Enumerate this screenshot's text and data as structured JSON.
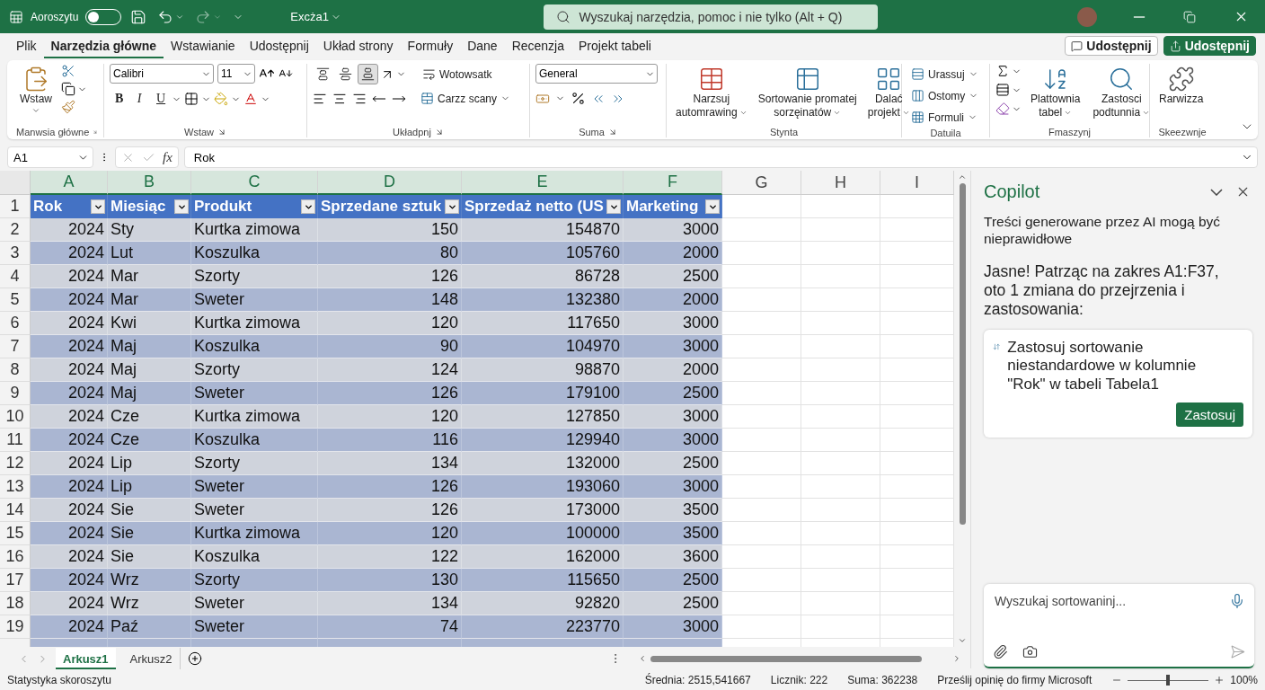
{
  "title_bar": {
    "autosave_label": "Aoroszytu",
    "autosave_on": false,
    "file_name": "Excża1",
    "search_placeholder": "Wyszukaj narzędzia, pomoc i nie tylko (Alt + Q)"
  },
  "menu_tabs": [
    {
      "label": "Plik",
      "selected": false
    },
    {
      "label": "Narzędzia główne",
      "selected": true
    },
    {
      "label": "Wstawianie",
      "selected": false
    },
    {
      "label": "Udostępnij",
      "selected": false
    },
    {
      "label": "Układ strony",
      "selected": false
    },
    {
      "label": "Formuły",
      "selected": false
    },
    {
      "label": "Dane",
      "selected": false
    },
    {
      "label": "Recenzja",
      "selected": false
    },
    {
      "label": "Projekt tabeli",
      "selected": false
    }
  ],
  "share_buttons": [
    "Udostępnij",
    "Udostępnij"
  ],
  "ribbon": {
    "clipboard": {
      "label": "Manwsia główne",
      "paste": "Wstaw"
    },
    "font": {
      "label": "Wstaw",
      "font": "Calibri",
      "size": "11",
      "styles": [
        "B",
        "I",
        "U"
      ]
    },
    "alignment": {
      "label": "Układpnj",
      "vertical_align": [
        {
          "selected": false
        },
        {
          "selected": false
        },
        {
          "selected": true
        }
      ],
      "wrap": "Wotowsatk",
      "merge": "Carzz scany"
    },
    "number": {
      "label": "Suma",
      "format": "General"
    },
    "styles": {
      "label": "Stynta",
      "buttons": [
        [
          "Narzsuj",
          "automrawing"
        ],
        [
          "Sortowanie promatej",
          "sorzęinatów"
        ],
        [
          "Dalać",
          "projekt"
        ]
      ]
    },
    "cells": {
      "label": "Datuila",
      "buttons": [
        "Urassuj",
        "Ostomy",
        "Formuli"
      ]
    },
    "editing": {
      "label": "Fmaszynj",
      "buttons": [
        [
          "Plattownia",
          "tabel"
        ],
        [
          "Zastosci",
          "podtunnia"
        ]
      ]
    },
    "addins": {
      "label": "Skeezwnje",
      "button": "Rarwizza"
    }
  },
  "formula_bar": {
    "cell_ref": "A1",
    "fx": "fx",
    "value": "Rok"
  },
  "columns": [
    {
      "label": "A",
      "selected": true
    },
    {
      "label": "B",
      "selected": true
    },
    {
      "label": "C",
      "selected": true
    },
    {
      "label": "D",
      "selected": true
    },
    {
      "label": "E",
      "selected": true
    },
    {
      "label": "F",
      "selected": true
    },
    {
      "label": "G",
      "selected": false
    },
    {
      "label": "H",
      "selected": false
    },
    {
      "label": "I",
      "selected": false
    }
  ],
  "row_numbers": [
    "1",
    "2",
    "3",
    "4",
    "5",
    "6",
    "7",
    "8",
    "9",
    "10",
    "11",
    "12",
    "13",
    "14",
    "15",
    "16",
    "17",
    "18",
    "19"
  ],
  "table": {
    "headers": [
      "Rok",
      "Miesiąc",
      "Produkt",
      "Sprzedane sztuk",
      "Sprzedaż netto (US",
      "Marketing"
    ],
    "rows": [
      [
        "2024",
        "Sty",
        "Kurtka zimowa",
        "150",
        "154870",
        "3000"
      ],
      [
        "2024",
        "Lut",
        "Koszulka",
        "80",
        "105760",
        "2000"
      ],
      [
        "2024",
        "Mar",
        "Szorty",
        "126",
        "86728",
        "2500"
      ],
      [
        "2024",
        "Mar",
        "Sweter",
        "148",
        "132380",
        "2000"
      ],
      [
        "2024",
        "Kwi",
        "Kurtka zimowa",
        "120",
        "117650",
        "3000"
      ],
      [
        "2024",
        "Maj",
        "Koszulka",
        "90",
        "104970",
        "3000"
      ],
      [
        "2024",
        "Maj",
        "Szorty",
        "124",
        "98870",
        "2000"
      ],
      [
        "2024",
        "Maj",
        "Sweter",
        "126",
        "179100",
        "2500"
      ],
      [
        "2024",
        "Cze",
        "Kurtka zimowa",
        "120",
        "127850",
        "3000"
      ],
      [
        "2024",
        "Cze",
        "Koszulka",
        "116",
        "129940",
        "3000"
      ],
      [
        "2024",
        "Lip",
        "Szorty",
        "134",
        "132000",
        "2500"
      ],
      [
        "2024",
        "Lip",
        "Sweter",
        "126",
        "193060",
        "3000"
      ],
      [
        "2024",
        "Sie",
        "Sweter",
        "126",
        "173000",
        "3500"
      ],
      [
        "2024",
        "Sie",
        "Kurtka zimowa",
        "120",
        "100000",
        "3500"
      ],
      [
        "2024",
        "Sie",
        "Koszulka",
        "122",
        "162000",
        "3600"
      ],
      [
        "2024",
        "Wrz",
        "Szorty",
        "130",
        "115650",
        "2500"
      ],
      [
        "2024",
        "Wrz",
        "Sweter",
        "134",
        "92820",
        "2500"
      ],
      [
        "2024",
        "Paź",
        "Sweter",
        "74",
        "223770",
        "3000"
      ]
    ]
  },
  "copilot": {
    "title": "Copilot",
    "disclaimer": "Treści generowane przez AI mogą być nieprawidłowe",
    "message": "Jasne! Patrząc na zakres A1:F37, oto 1 zmiana do przejrzenia i zastosowania:",
    "suggestion": "Zastosuj sortowanie niestandardowe w kolumnie \"Rok\" w tabeli Tabela1",
    "apply_button": "Zastosuj",
    "input_placeholder": "Wyszukaj sortowaninj..."
  },
  "sheet_tabs": [
    {
      "label": "Arkusz1",
      "selected": true
    },
    {
      "label": "Arkusz2",
      "selected": false
    }
  ],
  "status_bar": {
    "left": "Statystyka skoroszytu",
    "stats": [
      "Średnia: 2515,541667",
      "Licznik: 222",
      "Suma: 362238"
    ],
    "feedback": "Prześlij opinię do firmy Microsoft",
    "zoom": {
      "reading": "100%",
      "level": 0.5
    }
  }
}
